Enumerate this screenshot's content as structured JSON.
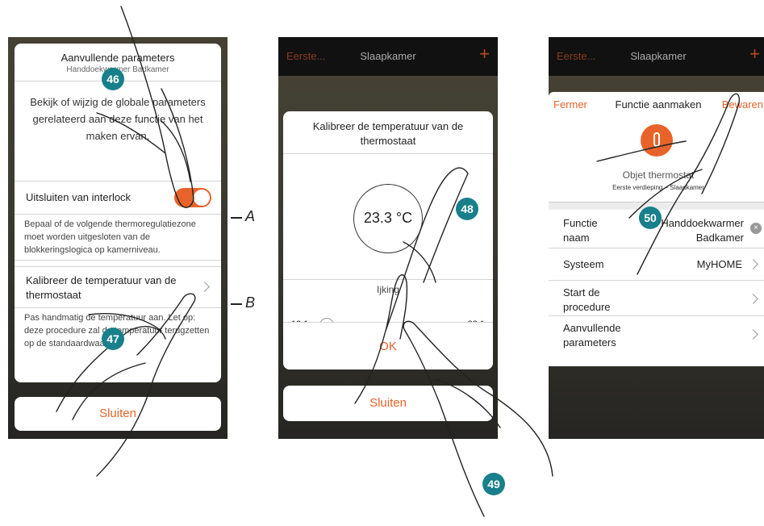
{
  "panel1": {
    "title": "Aanvullende parameters",
    "subtitle": "Handdoekwarmer Badkamer",
    "intro": "Bekijk of wijzig de globale parameters gerelateerd aan deze functie van het maken ervan.",
    "interlock_label": "Uitsluiten van interlock",
    "interlock_on": true,
    "interlock_hint": "Bepaal of de volgende thermoregulatiezone moet worden uitgesloten van de blokkeringslogica op kamerniveau.",
    "calibrate_label": "Kalibreer de temperatuur van de thermostaat",
    "calibrate_hint": "Pas handmatig de temperatuur aan. Let op: deze procedure zal de temperatuur terugzetten op de standaardwaarde.",
    "close_label": "Sluiten"
  },
  "panel2": {
    "nav": {
      "back": "Eerste...",
      "title": "Slaapkamer",
      "add": "+"
    },
    "dialog_title": "Kalibreer de temperatuur van de thermostaat",
    "temperature": "23.3 °C",
    "slider_label": "Ijking",
    "slider_min": "13.1",
    "slider_max": "33.1",
    "slider_value_fraction": 0.06,
    "ok_label": "OK",
    "close_label": "Sluiten"
  },
  "panel3": {
    "nav": {
      "back": "Eerste...",
      "title": "Slaapkamer",
      "add": "+"
    },
    "close_label": "Fermer",
    "header_title": "Functie aanmaken",
    "save_label": "Bewaren",
    "object_title": "Objet thermostat",
    "object_sub": "Eerste verdieping – Slaapkamer",
    "rows": [
      {
        "label": "Functie naam",
        "value": "Handdoekwarmer Badkamer"
      },
      {
        "label": "Systeem",
        "value": "MyHOME"
      },
      {
        "label": "Start de procedure",
        "value": ""
      },
      {
        "label": "Aanvullende parameters",
        "value": ""
      }
    ]
  },
  "callouts": {
    "a": "A",
    "b": "B"
  },
  "steps": {
    "s46": "46",
    "s47": "47",
    "s48": "48",
    "s49": "49",
    "s50": "50"
  },
  "colors": {
    "accent": "#e8632a",
    "marker": "#18808a"
  }
}
